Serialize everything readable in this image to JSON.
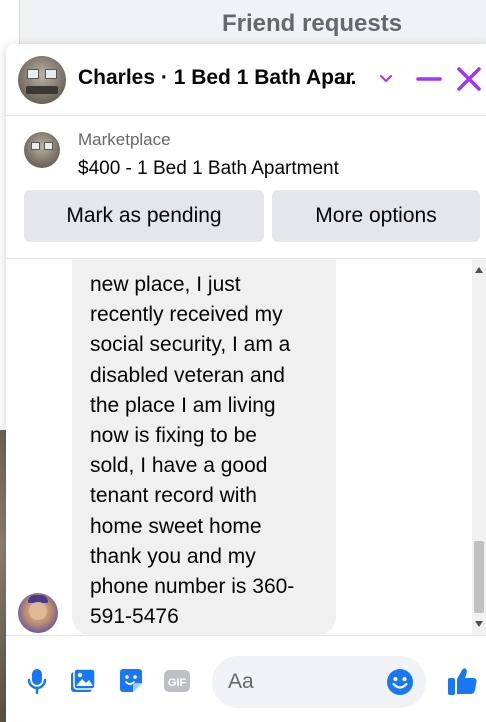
{
  "background": {
    "header_title": "Friend requests"
  },
  "chat": {
    "title": "Charles · 1 Bed 1 Bath Apar",
    "title_ellipsis": "...",
    "marketplace": {
      "label": "Marketplace",
      "listing": "$400 - 1 Bed 1 Bath Apartment"
    },
    "buttons": {
      "mark_pending": "Mark as pending",
      "more_options": "More options"
    },
    "message": {
      "text": "new place, I just\nrecently received my\nsocial security, I am a\ndisabled veteran and\nthe place I am living\nnow is fixing to be\nsold, I have a good\ntenant record with\nhome sweet home\nthank you and my\nphone number is 360-\n591-5476"
    },
    "composer": {
      "placeholder": "Aa"
    },
    "colors": {
      "accent": "#1877f2",
      "header_icons": "#a033ff",
      "bubble": "#f0f0f0"
    },
    "icons": [
      "chevron-down-icon",
      "minimize-icon",
      "close-icon",
      "microphone-icon",
      "photo-icon",
      "sticker-icon",
      "gif-icon",
      "emoji-icon",
      "thumbs-up-icon"
    ]
  }
}
